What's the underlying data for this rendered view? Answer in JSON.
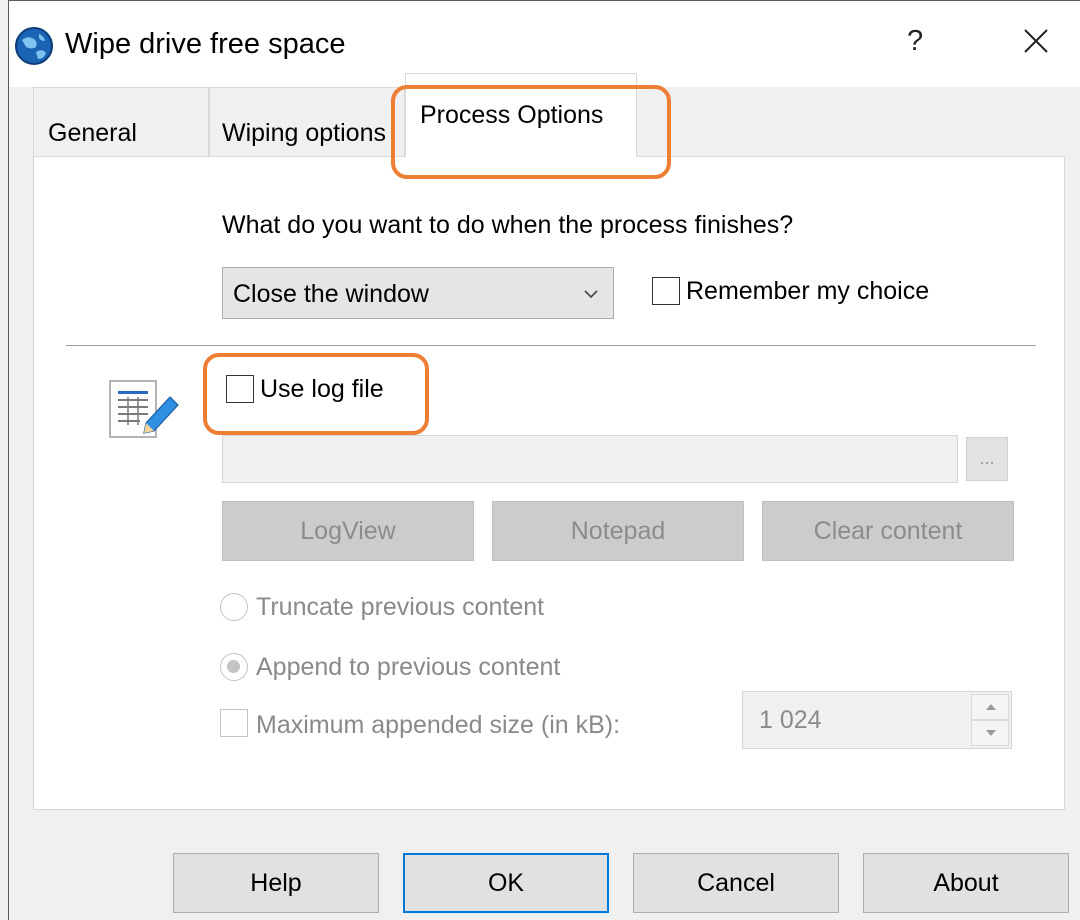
{
  "window": {
    "title": "Wipe drive free space",
    "help_button": "?",
    "icons": {
      "app": "globe-app-icon",
      "close": "close-icon",
      "log": "log-file-edit-icon"
    }
  },
  "tabs": [
    {
      "label": "General",
      "selected": false
    },
    {
      "label": "Wiping options",
      "selected": false
    },
    {
      "label": "Process Options",
      "selected": true
    }
  ],
  "process_options": {
    "question": "What do you want to do when the process finishes?",
    "finish_action": {
      "value": "Close the window"
    },
    "remember_choice": {
      "label": "Remember my choice",
      "checked": false
    },
    "use_log_file": {
      "label": "Use log file",
      "checked": false
    },
    "log_path": {
      "value": "",
      "enabled": false
    },
    "browse_label": "...",
    "log_buttons": {
      "logview": "LogView",
      "notepad": "Notepad",
      "clear": "Clear content"
    },
    "truncate": {
      "label": "Truncate previous content",
      "selected": false
    },
    "append": {
      "label": "Append to previous content",
      "selected": true
    },
    "max_size": {
      "label": "Maximum appended size (in kB):",
      "checked": false,
      "value": "1 024"
    }
  },
  "footer": {
    "help": "Help",
    "ok": "OK",
    "cancel": "Cancel",
    "about": "About"
  },
  "colors": {
    "highlight": "#ee7e33",
    "focus_border": "#0078d7",
    "disabled_text": "#8a8a8a"
  }
}
